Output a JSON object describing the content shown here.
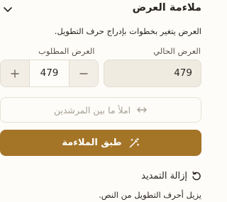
{
  "panel": {
    "title": "ملاءمة العرض",
    "chevron_icon": "chevron-down-icon",
    "description": "العرض يتغير بخطوات بإدراج حرف التطويل."
  },
  "current_width": {
    "label": "العرض الحالي",
    "value": "479"
  },
  "target_width": {
    "label": "العرض المطلوب",
    "value": "479",
    "increment_icon": "plus-icon",
    "decrement_icon": "minus-icon"
  },
  "fill_guides": {
    "label": "املأ ما بين المرشدين",
    "icon": "arrows-left-right-icon"
  },
  "apply_button": {
    "label": "طبق الملاءمة",
    "icon": "magic-wand-icon"
  },
  "remove_stretch": {
    "label": "إزالة التمديد",
    "icon": "undo-icon",
    "description": "يزيل أحرف التطويل من النص."
  },
  "colors": {
    "accent": "#a47427",
    "background": "#fdfcf8",
    "input_fill": "#efebe1",
    "text": "#2b2520",
    "muted": "#a8a196"
  }
}
